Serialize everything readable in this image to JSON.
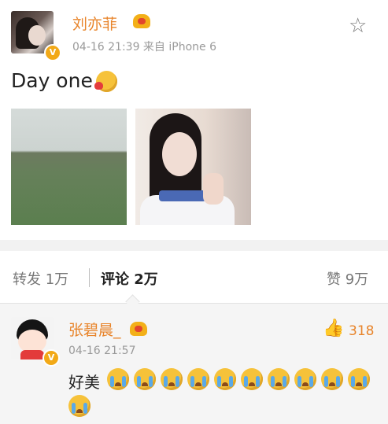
{
  "post": {
    "author": "刘亦菲",
    "meta": "04-16 21:39  来自 iPhone 6",
    "text": "Day one",
    "icons": {
      "favorite": "star-outline-icon",
      "verified": "verified-v-badge",
      "member": "crown-badge-icon",
      "emoji": "kiss-emoji"
    }
  },
  "actions": {
    "repost_label": "转发",
    "repost_count": "1万",
    "comment_label": "评论",
    "comment_count": "2万",
    "like_label": "赞",
    "like_count": "9万"
  },
  "comment": {
    "author": "张碧晨_",
    "meta": "04-16 21:57",
    "likes": "318",
    "text": "好美",
    "cry_emoji_count": 11,
    "icons": {
      "like": "thumbs-up-icon",
      "emoji": "crying-emoji"
    }
  },
  "colors": {
    "accent": "#e8842a",
    "badge": "#f2a917",
    "muted": "#9a9a9a"
  }
}
